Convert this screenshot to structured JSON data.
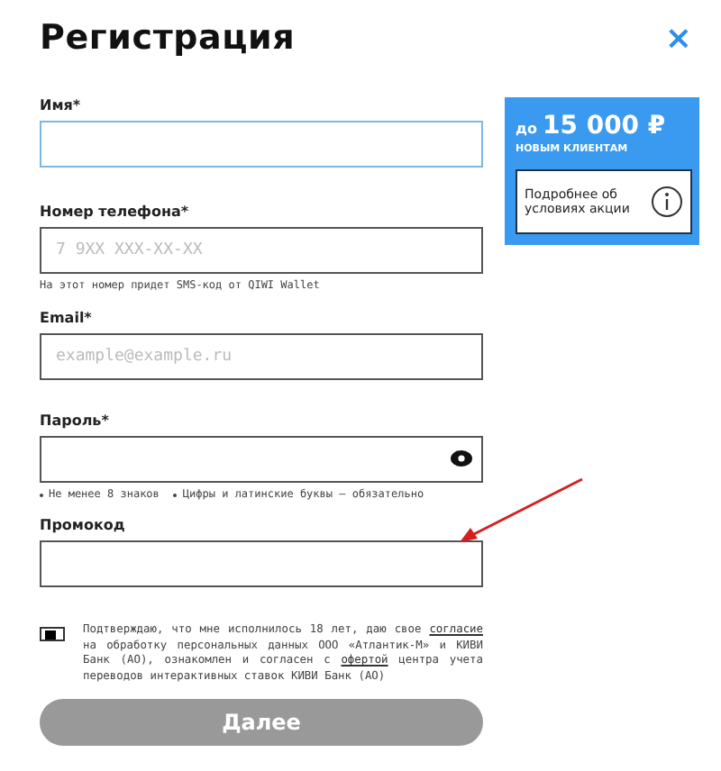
{
  "title": "Регистрация",
  "close": "×",
  "fields": [
    {
      "label": "Имя*",
      "focused": true,
      "kind": "text"
    },
    {
      "label": "Номер телефона*",
      "placeholder": "7 9XX XXX-XX-XX",
      "focused": false,
      "hint": "На этот номер придет SMS-код от QIWI Wallet",
      "kind": "text"
    },
    {
      "label": "Email*",
      "placeholder": "example@example.ru",
      "focused": false,
      "kind": "text"
    },
    {
      "label": "Пароль*",
      "focused": false,
      "kind": "password",
      "hints": [
        "Не менее 8 знаков",
        "Цифры и латинские буквы – обязательно"
      ]
    },
    {
      "label": "Промокод",
      "focused": false,
      "kind": "text"
    }
  ],
  "promo": {
    "prefix": "до",
    "amount": "15 000 ₽",
    "subtitle": "НОВЫМ КЛИЕНТАМ",
    "details_button": "Подробнее об условиях акции"
  },
  "consent": {
    "checked": true,
    "segments": [
      {
        "kind": "text",
        "text": "Подтверждаю, что мне исполнилось 18 лет, даю свое "
      },
      {
        "kind": "link",
        "text": "согласие"
      },
      {
        "kind": "text",
        "text": " на обработку персональных данных ООО «Атлантик-М» и КИВИ Банк (АО), ознакомлен и согласен с "
      },
      {
        "kind": "link",
        "text": "офертой"
      },
      {
        "kind": "text",
        "text": " центра учета переводов интерактивных ставок КИВИ Банк (АО)"
      }
    ]
  },
  "submit": {
    "label": "Далее",
    "disabled": true
  }
}
